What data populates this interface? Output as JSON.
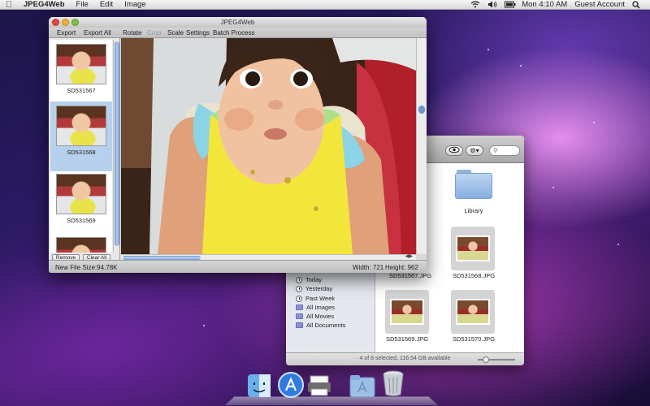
{
  "menubar": {
    "apple_icon": "apple-icon",
    "app_name": "JPEG4Web",
    "menus": [
      "File",
      "Edit",
      "Image"
    ],
    "status_icons": [
      "wifi-icon",
      "volume-icon",
      "battery-icon"
    ],
    "clock": "Mon 4:10 AM",
    "user": "Guest Account",
    "spotlight_icon": "spotlight-icon"
  },
  "app_window": {
    "title": "JPEG4Web",
    "toolbar": {
      "export": "Export",
      "export_all": "Export All",
      "rotate": "Rotate",
      "crop": "Crop",
      "scale": "Scale",
      "settings": "Settings",
      "batch_process": "Batch Process"
    },
    "images": [
      {
        "name": "SD531567",
        "selected": false
      },
      {
        "name": "SD531568",
        "selected": true
      },
      {
        "name": "SD531569",
        "selected": false
      },
      {
        "name": "",
        "selected": false
      }
    ],
    "remove_button": "Remove",
    "clear_all_button": "Clear All",
    "status": {
      "new_file_size": "New File Size:94.78K",
      "width": "Width: 721",
      "height": "Height: 962"
    }
  },
  "finder": {
    "sidebar": [
      {
        "label": "Today",
        "icon": "clock-icon"
      },
      {
        "label": "Yesterday",
        "icon": "clock-icon"
      },
      {
        "label": "Past Week",
        "icon": "clock-icon"
      },
      {
        "label": "All Images",
        "icon": "smart-folder-icon"
      },
      {
        "label": "All Movies",
        "icon": "smart-folder-icon"
      },
      {
        "label": "All Documents",
        "icon": "smart-folder-icon"
      }
    ],
    "items": [
      {
        "label": "Library",
        "type": "folder"
      },
      {
        "label": "SD531567.JPG",
        "type": "image"
      },
      {
        "label": "SD531568.JPG",
        "type": "image"
      },
      {
        "label": "SD531569.JPG",
        "type": "image"
      },
      {
        "label": "SD531570.JPG",
        "type": "image"
      }
    ],
    "status": "4 of 8 selected, 116.54 GB available"
  },
  "dock": {
    "items": [
      "finder-icon",
      "app-store-icon",
      "printer-icon",
      "applications-folder-icon",
      "trash-icon"
    ]
  }
}
